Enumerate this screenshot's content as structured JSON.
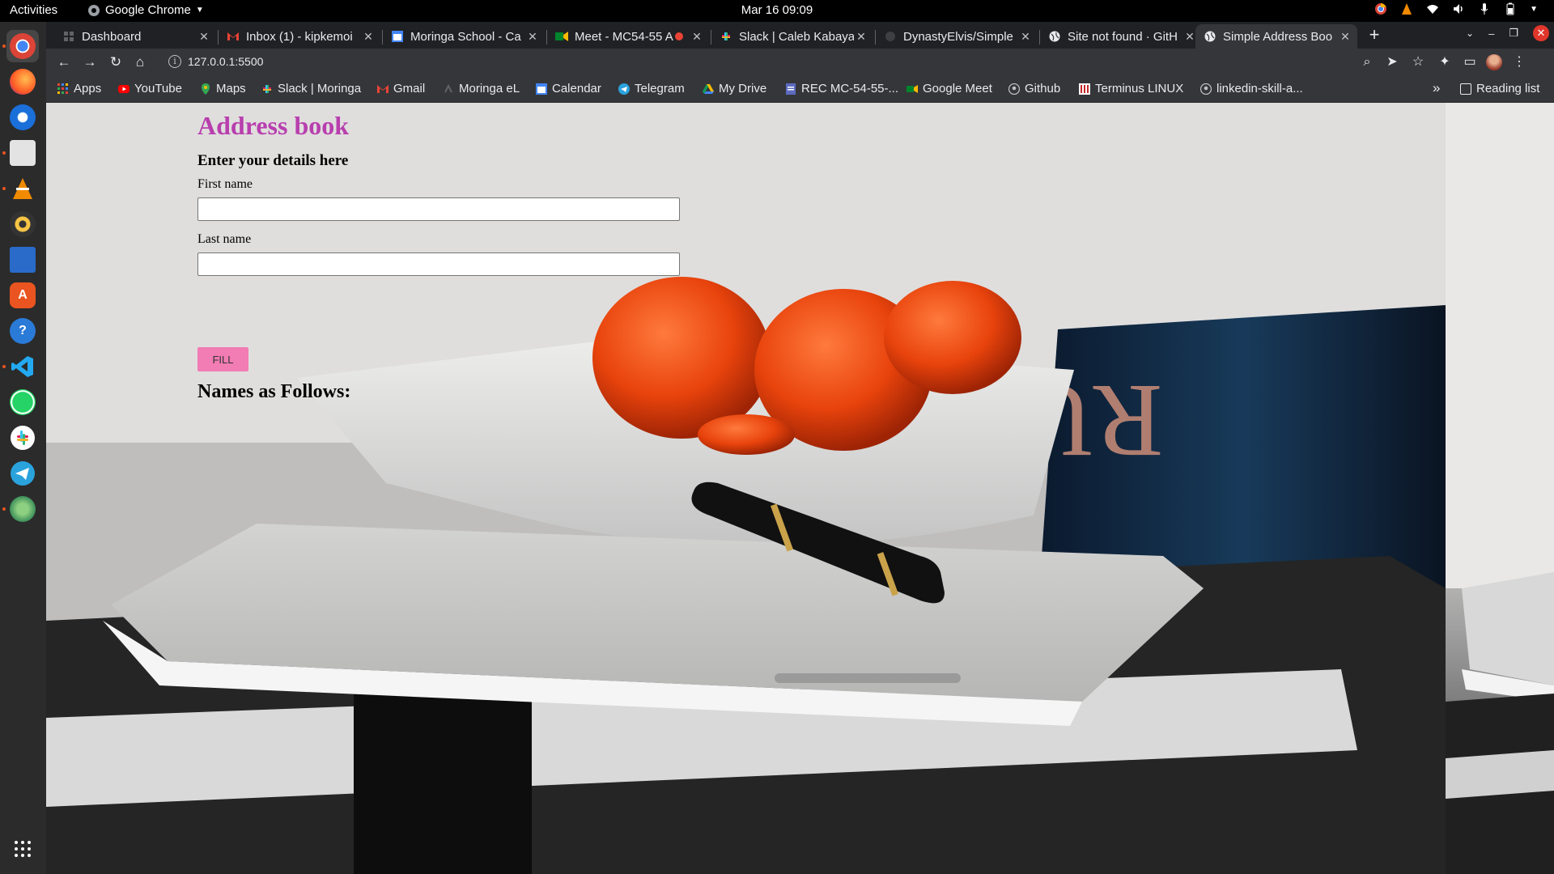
{
  "system": {
    "activities": "Activities",
    "app_menu": "Google Chrome",
    "clock": "Mar 16  09:09"
  },
  "tabs": [
    {
      "title": "Dashboard",
      "icon": "dashboard-icon"
    },
    {
      "title": "Inbox (1) - kipkemoi",
      "icon": "gmail-icon"
    },
    {
      "title": "Moringa School - Ca",
      "icon": "calendar-icon"
    },
    {
      "title": "Meet - MC54-55 A",
      "icon": "meet-icon"
    },
    {
      "title": "Slack | Caleb Kabaya",
      "icon": "slack-icon"
    },
    {
      "title": "DynastyElvis/Simple",
      "icon": "github-icon"
    },
    {
      "title": "Site not found · GitH",
      "icon": "globe-icon"
    },
    {
      "title": "Simple Address Boo",
      "icon": "globe-icon"
    }
  ],
  "address_bar": {
    "url": "127.0.0.1:5500"
  },
  "bookmarks": [
    {
      "label": "Apps",
      "icon": "apps-grid-icon"
    },
    {
      "label": "YouTube",
      "icon": "youtube-icon"
    },
    {
      "label": "Maps",
      "icon": "maps-icon"
    },
    {
      "label": "Slack | Moringa",
      "icon": "slack-icon"
    },
    {
      "label": "Gmail",
      "icon": "gmail-icon"
    },
    {
      "label": "Moringa eL",
      "icon": "moringa-icon"
    },
    {
      "label": "Calendar",
      "icon": "calendar-icon"
    },
    {
      "label": "Telegram",
      "icon": "telegram-icon"
    },
    {
      "label": "My Drive",
      "icon": "drive-icon"
    },
    {
      "label": "REC MC-54-55-...",
      "icon": "forms-icon"
    },
    {
      "label": "Google Meet",
      "icon": "meet-icon"
    },
    {
      "label": "Github",
      "icon": "github-icon"
    },
    {
      "label": "Terminus LINUX",
      "icon": "terminus-icon"
    },
    {
      "label": "linkedin-skill-a...",
      "icon": "github-icon"
    }
  ],
  "bookmarks_overflow": "»",
  "reading_list": "Reading list",
  "page": {
    "title": "Address book",
    "subtitle": "Enter your details here",
    "first_name_label": "First name",
    "first_name_value": "",
    "last_name_label": "Last name",
    "last_name_value": "",
    "fill_button": "FILL",
    "names_heading": "Names as Follows:"
  },
  "colors": {
    "title": "#b83fae",
    "button": "#f27cb4",
    "tab_strip": "#202124",
    "toolbar": "#35363a"
  }
}
